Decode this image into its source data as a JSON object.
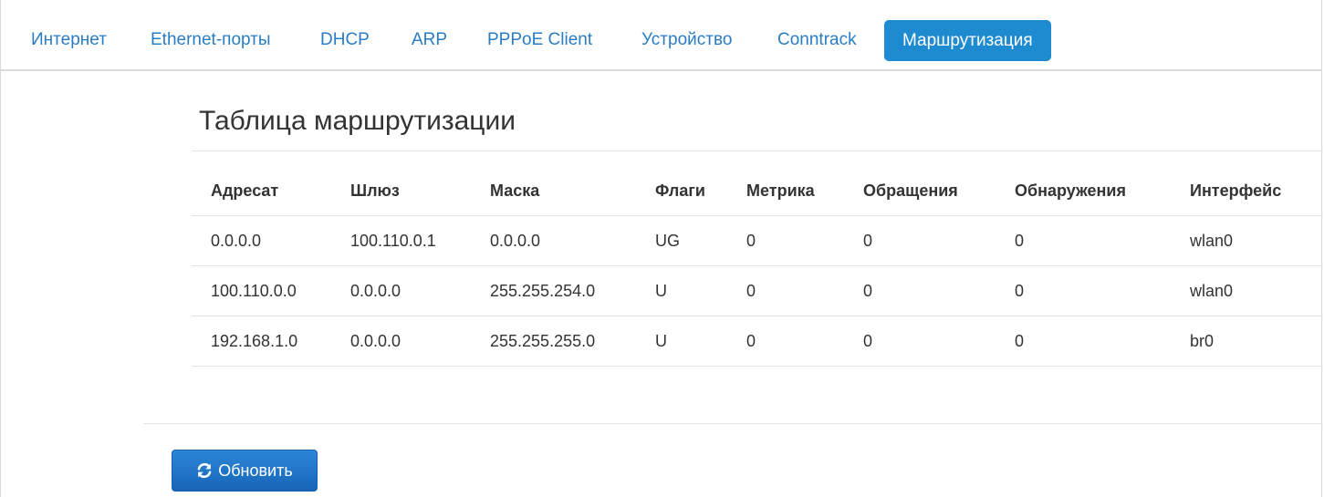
{
  "tabs": [
    {
      "label": "Интернет",
      "active": false
    },
    {
      "label": "Ethernet-порты",
      "active": false
    },
    {
      "label": "DHCP",
      "active": false
    },
    {
      "label": "ARP",
      "active": false
    },
    {
      "label": "PPPoE Client",
      "active": false
    },
    {
      "label": "Устройство",
      "active": false
    },
    {
      "label": "Conntrack",
      "active": false
    },
    {
      "label": "Маршрутизация",
      "active": true
    }
  ],
  "section": {
    "title": "Таблица маршрутизации"
  },
  "table": {
    "columns": [
      "Адресат",
      "Шлюз",
      "Маска",
      "Флаги",
      "Метрика",
      "Обращения",
      "Обнаружения",
      "Интерфейс"
    ],
    "rows": [
      [
        "0.0.0.0",
        "100.110.0.1",
        "0.0.0.0",
        "UG",
        "0",
        "0",
        "0",
        "wlan0"
      ],
      [
        "100.110.0.0",
        "0.0.0.0",
        "255.255.254.0",
        "U",
        "0",
        "0",
        "0",
        "wlan0"
      ],
      [
        "192.168.1.0",
        "0.0.0.0",
        "255.255.255.0",
        "U",
        "0",
        "0",
        "0",
        "br0"
      ]
    ]
  },
  "refresh_button": {
    "label": "Обновить",
    "icon": "refresh-icon"
  },
  "colors": {
    "accent": "#1e8ad0",
    "link": "#2a7dc4",
    "button": "#1865b8"
  }
}
